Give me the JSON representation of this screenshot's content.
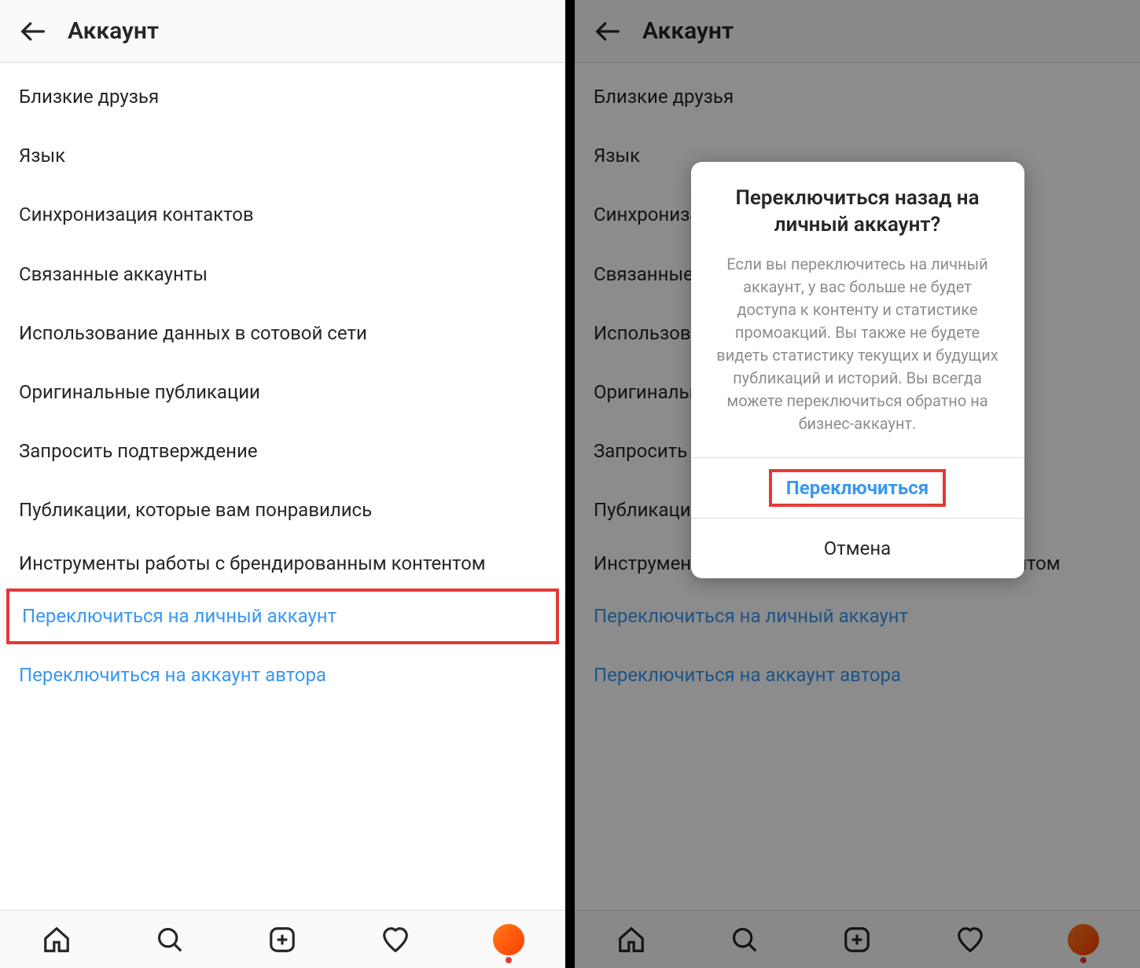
{
  "left": {
    "header_title": "Аккаунт",
    "menu": [
      "Близкие друзья",
      "Язык",
      "Синхронизация контактов",
      "Связанные аккаунты",
      "Использование данных в сотовой сети",
      "Оригинальные публикации",
      "Запросить подтверждение",
      "Публикации, которые вам понравились",
      "Инструменты работы с брендированным контентом"
    ],
    "link_primary": "Переключиться на личный аккаунт",
    "link_secondary": "Переключиться на аккаунт автора"
  },
  "right": {
    "header_title": "Аккаунт",
    "menu": [
      "Близкие друзья",
      "Язык",
      "Синхронизация контактов",
      "Связанные аккаунты",
      "Использование данных в сотовой сети",
      "Оригинальные публикации",
      "Запросить подтверждение",
      "Публикации, которые вам понравились",
      "Инструменты работы с брендированным контентом"
    ],
    "link_primary": "Переключиться на личный аккаунт",
    "link_secondary": "Переключиться на аккаунт автора",
    "dialog": {
      "title": "Переключиться назад на личный аккаунт?",
      "body": "Если вы переключитесь на личный аккаунт, у вас больше не будет доступа к контенту и статистике промоакций. Вы также не будете видеть статистику текущих и будущих публикаций и историй. Вы всегда можете переключиться обратно на бизнес-аккаунт.",
      "confirm": "Переключиться",
      "cancel": "Отмена"
    }
  }
}
